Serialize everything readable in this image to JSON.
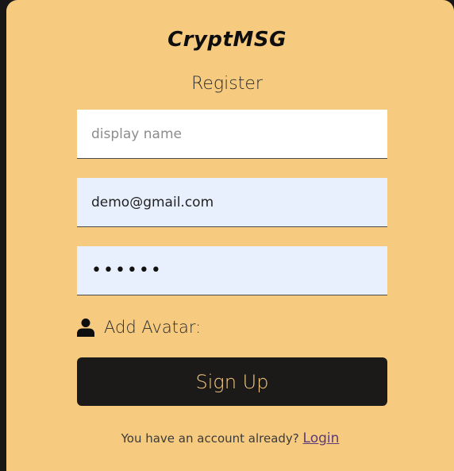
{
  "app": {
    "logo_text": "CryptMSG",
    "subtitle": "Register"
  },
  "form": {
    "display_name": {
      "placeholder": "display name",
      "value": ""
    },
    "email": {
      "value": "demo@gmail.com"
    },
    "password": {
      "value": "••••••"
    },
    "avatar_label": "Add Avatar:",
    "avatar_icon": "user-icon",
    "submit_label": "Sign Up"
  },
  "footer": {
    "prompt": "You have an account already? ",
    "login_link": "Login"
  },
  "colors": {
    "card_background": "#f6cb80",
    "page_background": "#171717",
    "button_background": "#1b1a19",
    "button_text": "#f6cb80",
    "autofill_field": "#e8f0fe"
  }
}
